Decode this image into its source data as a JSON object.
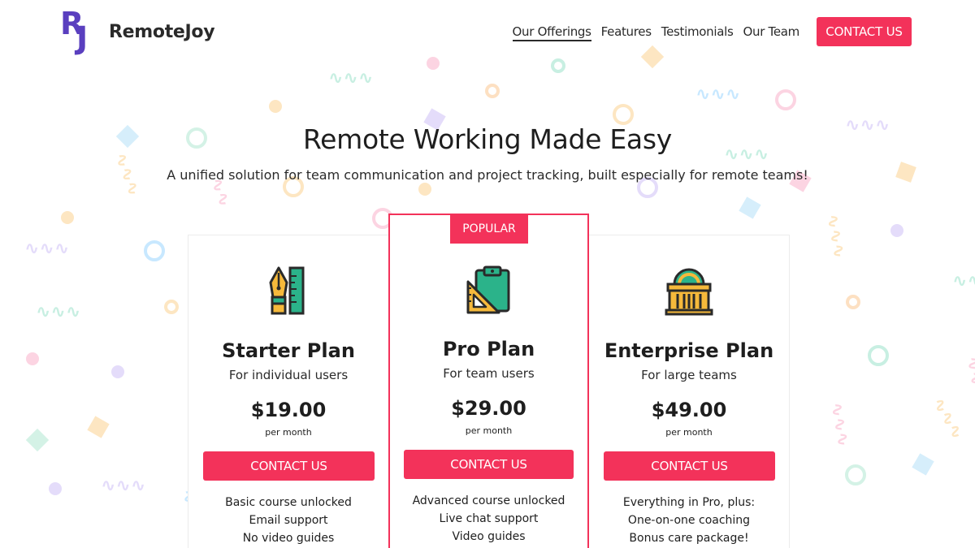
{
  "brand": {
    "name": "RemoteJoy",
    "logo_letters": "RJ",
    "primary_color": "#f3325a",
    "logo_color": "#5a3fbf"
  },
  "nav": {
    "items": [
      {
        "label": "Our Offerings",
        "active": true
      },
      {
        "label": "Features",
        "active": false
      },
      {
        "label": "Testimonials",
        "active": false
      },
      {
        "label": "Our Team",
        "active": false
      }
    ],
    "cta_label": "CONTACT US"
  },
  "hero": {
    "title": "Remote Working Made Easy",
    "subtitle": "A unified solution for team communication and project tracking, built especially for remote teams!"
  },
  "plans": [
    {
      "icon": "pen-ruler-icon",
      "name": "Starter Plan",
      "audience": "For individual users",
      "price": "$19.00",
      "period": "per month",
      "button": "CONTACT US",
      "features": [
        "Basic course unlocked",
        "Email support",
        "No video guides"
      ]
    },
    {
      "badge": "POPULAR",
      "icon": "clipboard-icon",
      "name": "Pro Plan",
      "audience": "For team users",
      "price": "$29.00",
      "period": "per month",
      "button": "CONTACT US",
      "features": [
        "Advanced course unlocked",
        "Live chat support",
        "Video guides"
      ]
    },
    {
      "icon": "building-icon",
      "name": "Enterprise Plan",
      "audience": "For large teams",
      "price": "$49.00",
      "period": "per month",
      "button": "CONTACT US",
      "features": [
        "Everything in Pro, plus:",
        "One-on-one coaching",
        "Bonus care package!"
      ]
    }
  ]
}
